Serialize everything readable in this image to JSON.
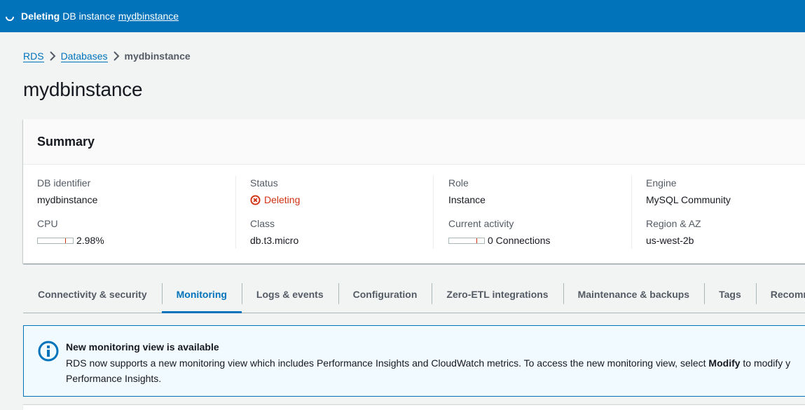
{
  "flashbar": {
    "prefix": "Deleting",
    "middle": "DB instance",
    "link": "mydbinstance"
  },
  "breadcrumb": {
    "items": [
      {
        "label": "RDS"
      },
      {
        "label": "Databases"
      },
      {
        "label": "mydbinstance"
      }
    ]
  },
  "page": {
    "title": "mydbinstance"
  },
  "summary": {
    "title": "Summary",
    "db_identifier_label": "DB identifier",
    "db_identifier_value": "mydbinstance",
    "cpu_label": "CPU",
    "cpu_value": "2.98%",
    "cpu_fraction": 0.0298,
    "status_label": "Status",
    "status_value": "Deleting",
    "class_label": "Class",
    "class_value": "db.t3.micro",
    "role_label": "Role",
    "role_value": "Instance",
    "activity_label": "Current activity",
    "activity_value": "0 Connections",
    "engine_label": "Engine",
    "engine_value": "MySQL Community",
    "region_label": "Region & AZ",
    "region_value": "us-west-2b"
  },
  "tabs": [
    {
      "label": "Connectivity & security"
    },
    {
      "label": "Monitoring",
      "active": true
    },
    {
      "label": "Logs & events"
    },
    {
      "label": "Configuration"
    },
    {
      "label": "Zero-ETL integrations"
    },
    {
      "label": "Maintenance & backups"
    },
    {
      "label": "Tags"
    },
    {
      "label": "Recomme"
    }
  ],
  "alert": {
    "title": "New monitoring view is available",
    "body_before": "RDS now supports a new monitoring view which includes Performance Insights and CloudWatch metrics. To access the new monitoring view, select ",
    "body_strong": "Modify",
    "body_after": " to modify y",
    "body_line2": "Performance Insights."
  },
  "colors": {
    "accent": "#0073bb",
    "error": "#d13212",
    "info_bg": "#f1faff"
  },
  "icons": {
    "flash": "spinner-icon",
    "breadcrumb_sep": "chevron-right-icon",
    "status": "error-circle-icon",
    "alert": "info-icon"
  }
}
